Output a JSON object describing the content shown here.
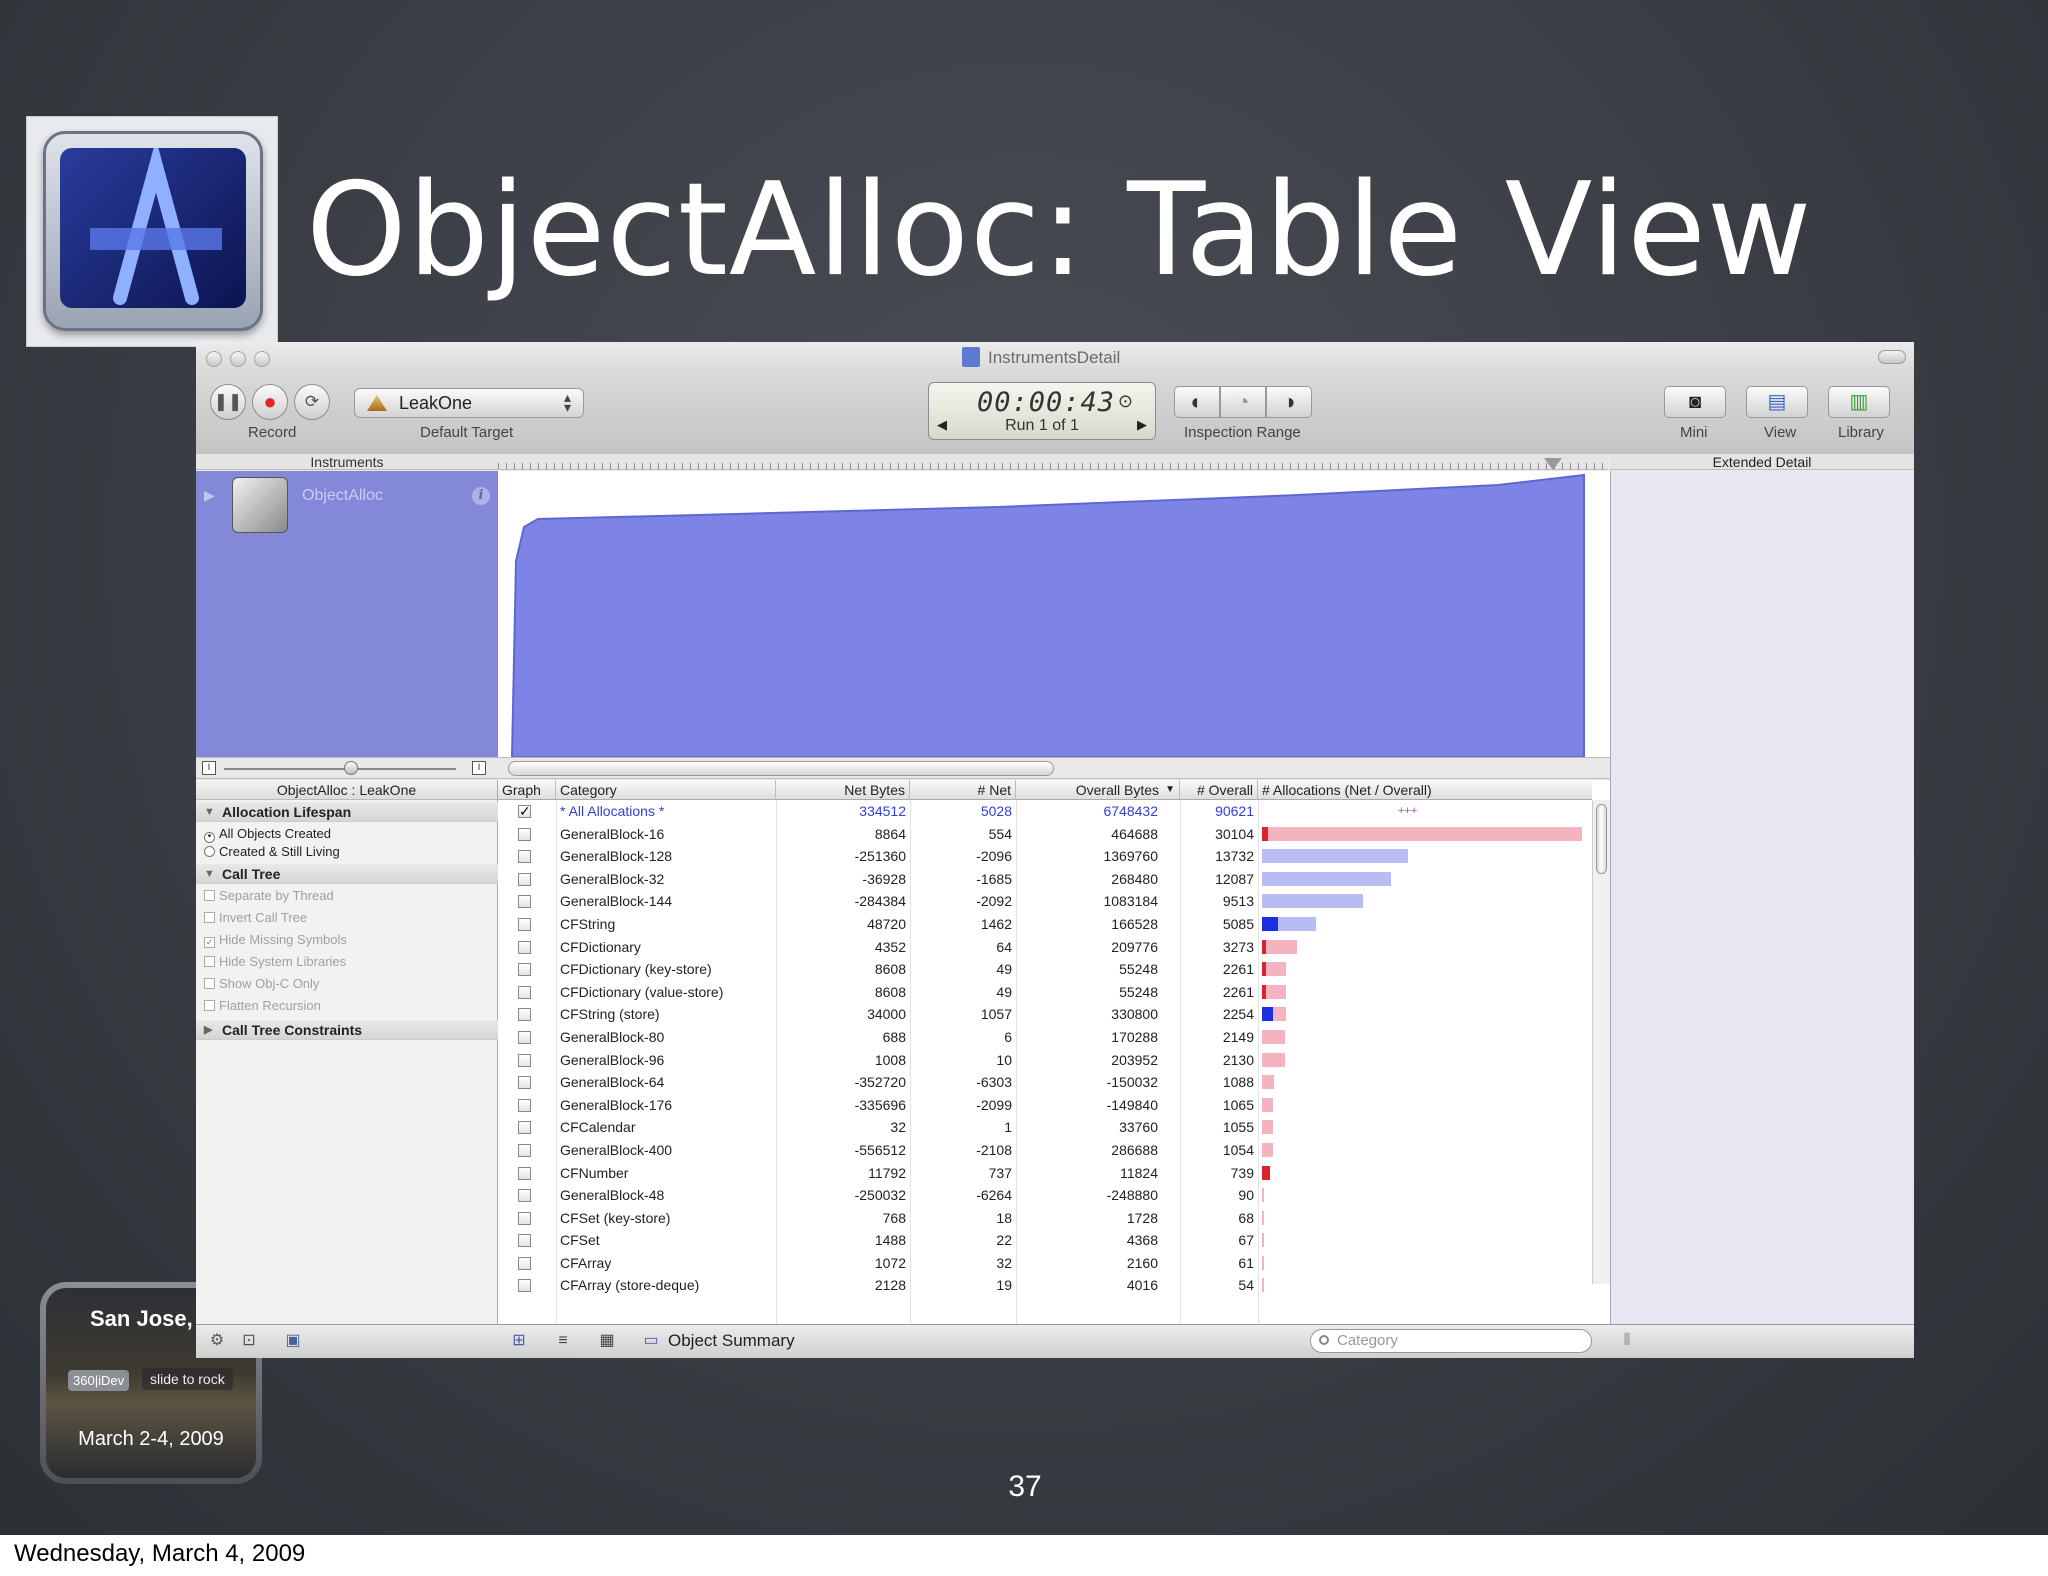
{
  "slide": {
    "title": "ObjectAlloc: Table View",
    "page_number": "37",
    "footer_date": "Wednesday, March 4, 2009",
    "badge": {
      "city": "San Jose, CA",
      "tag": "360|iDev",
      "slide": "slide to rock",
      "date": "March 2-4, 2009"
    }
  },
  "window": {
    "title": "InstrumentsDetail",
    "toolbar": {
      "record_label": "Record",
      "target_name": "LeakOne",
      "target_label": "Default Target",
      "timer": "00:00:43",
      "run": "Run 1 of 1",
      "inspection_label": "Inspection Range",
      "mini_label": "Mini",
      "view_label": "View",
      "library_label": "Library"
    },
    "instruments_header": "Instruments",
    "extended_detail_header": "Extended Detail",
    "instrument_name": "ObjectAlloc",
    "detail": {
      "title": "ObjectAlloc : LeakOne",
      "section_lifespan": "Allocation Lifespan",
      "opt_all": "All Objects Created",
      "opt_living": "Created & Still Living",
      "section_calltree": "Call Tree",
      "opt_sep": "Separate by Thread",
      "opt_invert": "Invert Call Tree",
      "opt_hide_missing": "Hide Missing Symbols",
      "opt_hide_system": "Hide System Libraries",
      "opt_objc": "Show Obj-C Only",
      "opt_flatten": "Flatten Recursion",
      "section_constraints": "Call Tree Constraints"
    },
    "table": {
      "columns": {
        "graph": "Graph",
        "category": "Category",
        "net_bytes": "Net Bytes",
        "net": "# Net",
        "overall_bytes": "Overall Bytes",
        "overall": "# Overall",
        "allocations": "# Allocations (Net / Overall)"
      },
      "rows": [
        {
          "category": "* All Allocations *",
          "net_bytes": "334512",
          "net": "5028",
          "overall_bytes": "6748432",
          "overall": "90621",
          "checked": true,
          "selected": true,
          "net_frac": 0,
          "overall_frac": 0
        },
        {
          "category": "GeneralBlock-16",
          "net_bytes": "8864",
          "net": "554",
          "overall_bytes": "464688",
          "overall": "30104",
          "net_frac": 0.018,
          "overall_frac": 1.0
        },
        {
          "category": "GeneralBlock-128",
          "net_bytes": "-251360",
          "net": "-2096",
          "overall_bytes": "1369760",
          "overall": "13732",
          "net_frac": 0,
          "overall_frac": 0.456
        },
        {
          "category": "GeneralBlock-32",
          "net_bytes": "-36928",
          "net": "-1685",
          "overall_bytes": "268480",
          "overall": "12087",
          "net_frac": 0,
          "overall_frac": 0.402
        },
        {
          "category": "GeneralBlock-144",
          "net_bytes": "-284384",
          "net": "-2092",
          "overall_bytes": "1083184",
          "overall": "9513",
          "net_frac": 0,
          "overall_frac": 0.316
        },
        {
          "category": "CFString",
          "net_bytes": "48720",
          "net": "1462",
          "overall_bytes": "166528",
          "overall": "5085",
          "net_frac": 0.049,
          "overall_frac": 0.169
        },
        {
          "category": "CFDictionary",
          "net_bytes": "4352",
          "net": "64",
          "overall_bytes": "209776",
          "overall": "3273",
          "net_frac": 0.002,
          "overall_frac": 0.109
        },
        {
          "category": "CFDictionary (key-store)",
          "net_bytes": "8608",
          "net": "49",
          "overall_bytes": "55248",
          "overall": "2261",
          "net_frac": 0.002,
          "overall_frac": 0.075
        },
        {
          "category": "CFDictionary (value-store)",
          "net_bytes": "8608",
          "net": "49",
          "overall_bytes": "55248",
          "overall": "2261",
          "net_frac": 0.002,
          "overall_frac": 0.075
        },
        {
          "category": "CFString (store)",
          "net_bytes": "34000",
          "net": "1057",
          "overall_bytes": "330800",
          "overall": "2254",
          "net_frac": 0.035,
          "overall_frac": 0.075
        },
        {
          "category": "GeneralBlock-80",
          "net_bytes": "688",
          "net": "6",
          "overall_bytes": "170288",
          "overall": "2149",
          "net_frac": 0,
          "overall_frac": 0.071
        },
        {
          "category": "GeneralBlock-96",
          "net_bytes": "1008",
          "net": "10",
          "overall_bytes": "203952",
          "overall": "2130",
          "net_frac": 0,
          "overall_frac": 0.071
        },
        {
          "category": "GeneralBlock-64",
          "net_bytes": "-352720",
          "net": "-6303",
          "overall_bytes": "-150032",
          "overall": "1088",
          "net_frac": 0,
          "overall_frac": 0.036
        },
        {
          "category": "GeneralBlock-176",
          "net_bytes": "-335696",
          "net": "-2099",
          "overall_bytes": "-149840",
          "overall": "1065",
          "net_frac": 0,
          "overall_frac": 0.035
        },
        {
          "category": "CFCalendar",
          "net_bytes": "32",
          "net": "1",
          "overall_bytes": "33760",
          "overall": "1055",
          "net_frac": 0,
          "overall_frac": 0.035
        },
        {
          "category": "GeneralBlock-400",
          "net_bytes": "-556512",
          "net": "-2108",
          "overall_bytes": "286688",
          "overall": "1054",
          "net_frac": 0,
          "overall_frac": 0.035
        },
        {
          "category": "CFNumber",
          "net_bytes": "11792",
          "net": "737",
          "overall_bytes": "11824",
          "overall": "739",
          "net_frac": 0.024,
          "overall_frac": 0.025
        },
        {
          "category": "GeneralBlock-48",
          "net_bytes": "-250032",
          "net": "-6264",
          "overall_bytes": "-248880",
          "overall": "90",
          "net_frac": 0,
          "overall_frac": 0.003
        },
        {
          "category": "CFSet (key-store)",
          "net_bytes": "768",
          "net": "18",
          "overall_bytes": "1728",
          "overall": "68",
          "net_frac": 0,
          "overall_frac": 0.002
        },
        {
          "category": "CFSet",
          "net_bytes": "1488",
          "net": "22",
          "overall_bytes": "4368",
          "overall": "67",
          "net_frac": 0,
          "overall_frac": 0.002
        },
        {
          "category": "CFArray",
          "net_bytes": "1072",
          "net": "32",
          "overall_bytes": "2160",
          "overall": "61",
          "net_frac": 0,
          "overall_frac": 0.002
        },
        {
          "category": "CFArray (store-deque)",
          "net_bytes": "2128",
          "net": "19",
          "overall_bytes": "4016",
          "overall": "54",
          "net_frac": 0,
          "overall_frac": 0.002
        }
      ]
    },
    "bottom": {
      "breadcrumb": "Object Summary",
      "search_placeholder": "Category"
    },
    "colors": {
      "graph_fill": "#7d84e6",
      "graph_bg_row": "#8389d8",
      "bar_overall": "#f3b3c0",
      "bar_overall_alt": "#b8bcf2",
      "bar_net_red": "#d8242c",
      "bar_net_blue": "#1c2ee0",
      "selected_text": "#3140d8"
    }
  }
}
